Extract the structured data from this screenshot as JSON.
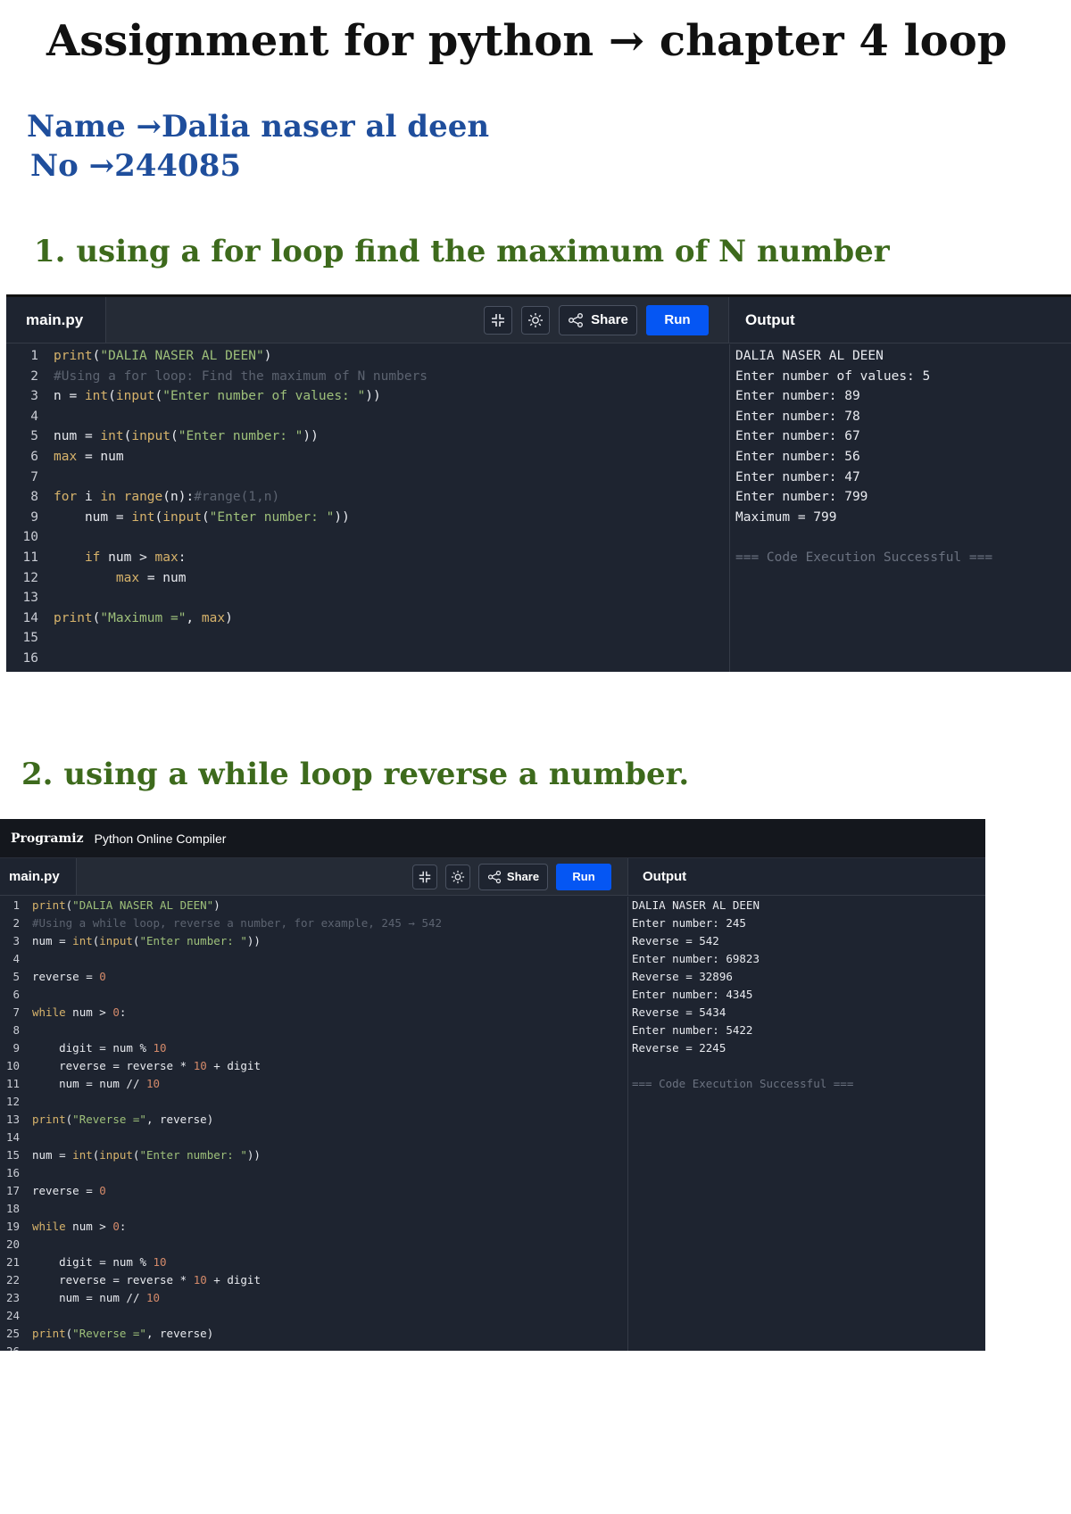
{
  "document": {
    "title": "Assignment for python → chapter 4 loop",
    "name_line": "Name →Dalia naser al deen",
    "number_line": "No →244085",
    "name_color": "#1f4e9c",
    "heading_color": "#3d6a1c"
  },
  "sections": [
    {
      "heading": "1. using a for loop find the maximum of N number",
      "compiler": {
        "file_tab": "main.py",
        "share_label": "Share",
        "run_label": "Run",
        "output_label": "Output",
        "code": [
          "print(\"DALIA NASER AL DEEN\")",
          "#Using a for loop: Find the maximum of N numbers",
          "n = int(input(\"Enter number of values: \"))",
          "",
          "num = int(input(\"Enter number: \"))",
          "max = num",
          "",
          "for i in range(n):#range(1,n)",
          "    num = int(input(\"Enter number: \"))",
          "",
          "    if num > max:",
          "        max = num",
          "",
          "print(\"Maximum =\", max)",
          "",
          ""
        ],
        "output": [
          "DALIA NASER AL DEEN",
          "Enter number of values: 5",
          "Enter number: 89",
          "Enter number: 78",
          "Enter number: 67",
          "Enter number: 56",
          "Enter number: 47",
          "Enter number: 799",
          "Maximum = 799",
          "",
          "=== Code Execution Successful ==="
        ]
      }
    },
    {
      "heading": "2. using a while loop reverse a number.",
      "compiler": {
        "brand_logo": "Programiz",
        "brand_name": "Python Online Compiler",
        "file_tab": "main.py",
        "share_label": "Share",
        "run_label": "Run",
        "output_label": "Output",
        "code": [
          "print(\"DALIA NASER AL DEEN\")",
          "#Using a while loop, reverse a number, for example, 245 → 542",
          "num = int(input(\"Enter number: \"))",
          "",
          "reverse = 0",
          "",
          "while num > 0:",
          "",
          "    digit = num % 10",
          "    reverse = reverse * 10 + digit",
          "    num = num // 10",
          "",
          "print(\"Reverse =\", reverse)",
          "",
          "num = int(input(\"Enter number: \"))",
          "",
          "reverse = 0",
          "",
          "while num > 0:",
          "",
          "    digit = num % 10",
          "    reverse = reverse * 10 + digit",
          "    num = num // 10",
          "",
          "print(\"Reverse =\", reverse)",
          ""
        ],
        "output": [
          "DALIA NASER AL DEEN",
          "Enter number: 245",
          "Reverse = 542",
          "Enter number: 69823",
          "Reverse = 32896",
          "Enter number: 4345",
          "Reverse = 5434",
          "Enter number: 5422",
          "Reverse = 2245",
          "",
          "=== Code Execution Successful ==="
        ]
      }
    }
  ],
  "icons": {
    "minimize": "minimize-icon",
    "theme": "theme-sun-icon",
    "share": "share-icon"
  },
  "colors": {
    "panel_bg": "#1e2430",
    "toolbar_bg": "#252b36",
    "run_button": "#0556f3",
    "keyword": "#d7b36b",
    "string": "#9ec07a",
    "number": "#d48a6a",
    "comment": "#5c6370"
  }
}
